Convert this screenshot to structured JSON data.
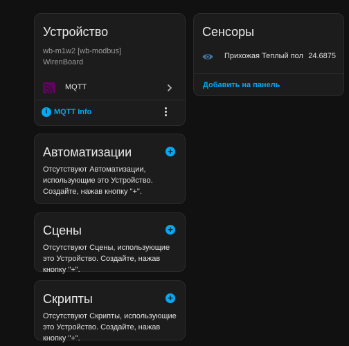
{
  "device": {
    "title": "Устройство",
    "model": "wb-m1w2 [wb-modbus]",
    "manufacturer": "WirenBoard",
    "integration": {
      "label": "MQTT",
      "icon": "mqtt-icon"
    },
    "info_link": "MQTT Info",
    "info_icon": "info-icon",
    "menu_icon": "more-vertical-icon"
  },
  "automations": {
    "title": "Автоматизации",
    "text": "Отсутствуют Автоматизации, использующие это Устройство. Создайте, нажав кнопку \"+\"."
  },
  "scenes": {
    "title": "Сцены",
    "text": "Отсутствуют Сцены, использующие это Устройство. Создайте, нажав кнопку \"+\"."
  },
  "scripts": {
    "title": "Скрипты",
    "text": "Отсутствуют Скрипты, использующие это Устройство. Создайте, нажав кнопку \"+\"."
  },
  "sensors": {
    "title": "Сенсоры",
    "items": [
      {
        "name": "Прихожая Теплый пол",
        "value": "24.6875",
        "icon": "eye-icon"
      }
    ],
    "add_link": "Добавить на панель"
  },
  "colors": {
    "accent": "#03a9f4",
    "mqtt_brand": "#660066",
    "card_bg": "#1c1c1c",
    "page_bg": "#111111"
  }
}
